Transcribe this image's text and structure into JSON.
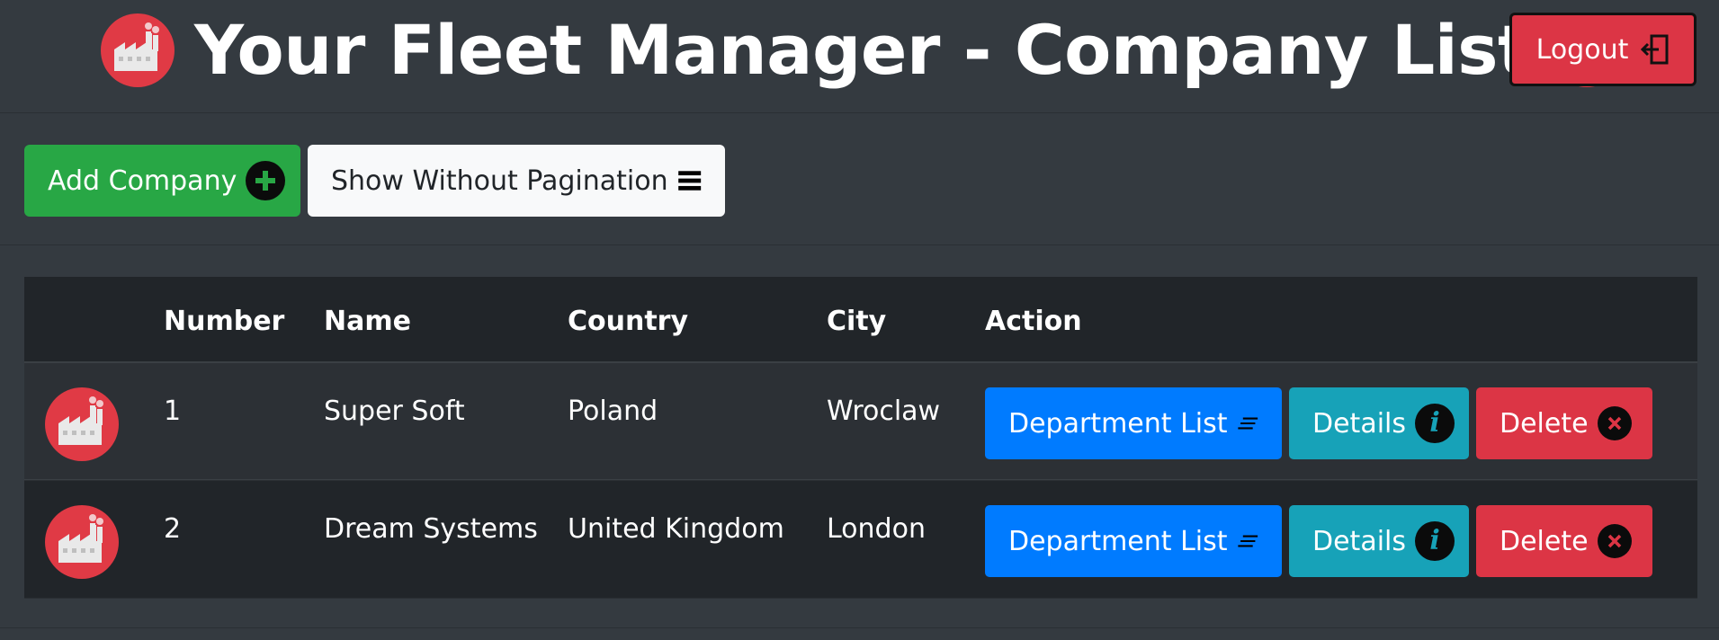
{
  "header": {
    "title": "Your Fleet Manager - Company List",
    "logout_label": "Logout"
  },
  "toolbar": {
    "add_company_label": "Add Company",
    "show_without_pagination_label": "Show Without Pagination"
  },
  "table": {
    "columns": [
      "",
      "Number",
      "Name",
      "Country",
      "City",
      "Action"
    ],
    "rows": [
      {
        "number": "1",
        "name": "Super Soft",
        "country": "Poland",
        "city": "Wroclaw",
        "actions": [
          "Department List",
          "Details",
          "Delete"
        ]
      },
      {
        "number": "2",
        "name": "Dream Systems",
        "country": "United Kingdom",
        "city": "London",
        "actions": [
          "Department List",
          "Details",
          "Delete"
        ]
      }
    ]
  },
  "icons": {
    "title_left": "factory-icon",
    "title_right": "factory-icon",
    "logout": "logout-icon",
    "add": "plus-circle-icon",
    "no_pagination": "list-icon",
    "row": "factory-icon",
    "department_list": "text-lines-icon",
    "details": "info-icon",
    "delete": "x-circle-icon"
  },
  "colors": {
    "background": "#343a40",
    "table_header": "#212529",
    "success": "#28a745",
    "primary": "#007bff",
    "info": "#17a2b8",
    "danger": "#dc3545",
    "light": "#f8f9fa"
  }
}
